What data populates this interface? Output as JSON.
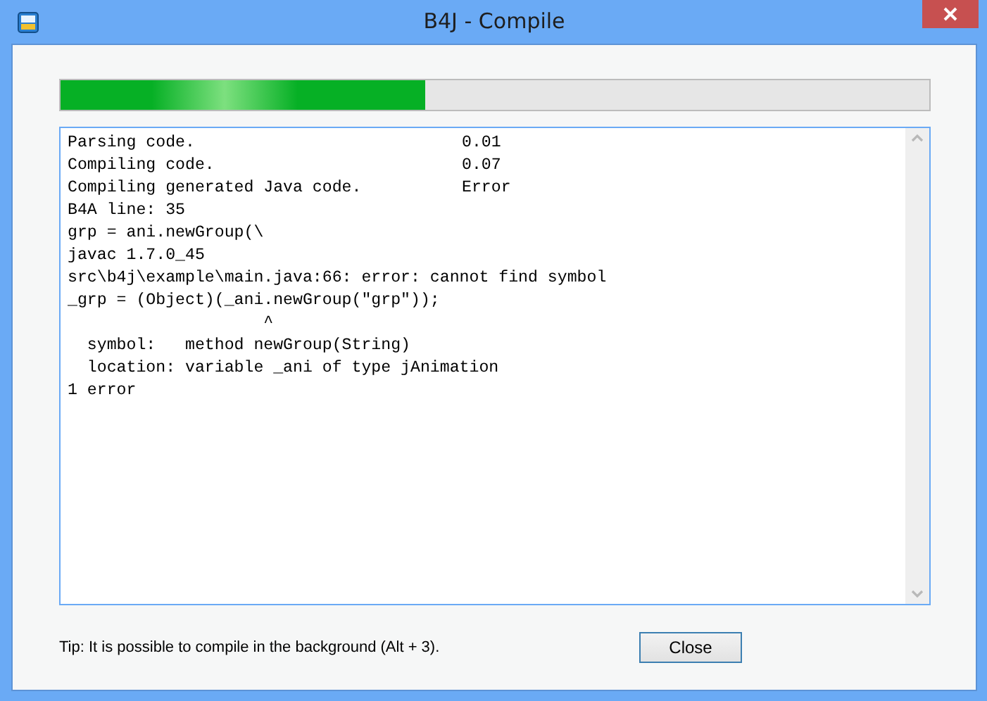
{
  "window": {
    "title": "B4J - Compile"
  },
  "progress": {
    "level": 0.42
  },
  "log": [
    {
      "text": "Parsing code.",
      "value": "0.01"
    },
    {
      "text": "Compiling code.",
      "value": "0.07"
    },
    {
      "text": "Compiling generated Java code.",
      "value": "Error"
    },
    {
      "text": "B4A line: 35"
    },
    {
      "text": "grp = ani.newGroup(\\"
    },
    {
      "text": "javac 1.7.0_45"
    },
    {
      "text": "src\\b4j\\example\\main.java:66: error: cannot find symbol"
    },
    {
      "text": "_grp = (Object)(_ani.newGroup(\"grp\"));"
    },
    {
      "text": "                    ^"
    },
    {
      "text": "  symbol:   method newGroup(String)"
    },
    {
      "text": "  location: variable _ani of type jAnimation"
    },
    {
      "text": "1 error"
    }
  ],
  "tip": "Tip: It is possible to compile in the background (Alt + 3).",
  "buttons": [
    {
      "label": "Close"
    }
  ]
}
